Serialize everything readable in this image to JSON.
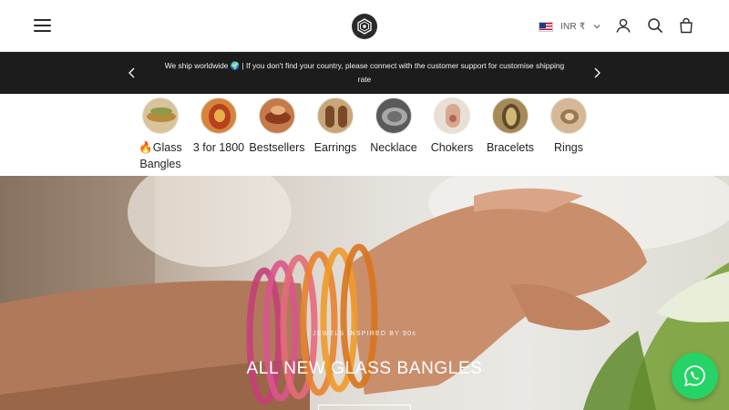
{
  "header": {
    "menu_icon": "menu-icon",
    "logo_icon": "brand-logo-icon",
    "currency": {
      "label": "INR ₹",
      "flag_icon": "us-flag-icon",
      "chevron_icon": "chevron-down-icon"
    },
    "icons": [
      "account-icon",
      "search-icon",
      "cart-icon"
    ]
  },
  "announcement": {
    "text": "We ship worldwide 🌍 | If you don't find your country, please connect with the customer support for customise shipping rate",
    "prev_icon": "chevron-left-icon",
    "next_icon": "chevron-right-icon"
  },
  "categories": [
    {
      "label": "🔥Glass Bangles"
    },
    {
      "label": "3 for 1800"
    },
    {
      "label": "Bestsellers"
    },
    {
      "label": "Earrings"
    },
    {
      "label": "Necklace"
    },
    {
      "label": "Chokers"
    },
    {
      "label": "Bracelets"
    },
    {
      "label": "Rings"
    }
  ],
  "hero": {
    "eyebrow": "JEWELS INSPIRED BY 90s",
    "title": "ALL NEW GLASS BANGLES"
  },
  "whatsapp": {
    "icon": "whatsapp-icon"
  },
  "colors": {
    "announcement_bg": "#1c1c1c",
    "whatsapp_green": "#25d366",
    "text": "#222222"
  }
}
